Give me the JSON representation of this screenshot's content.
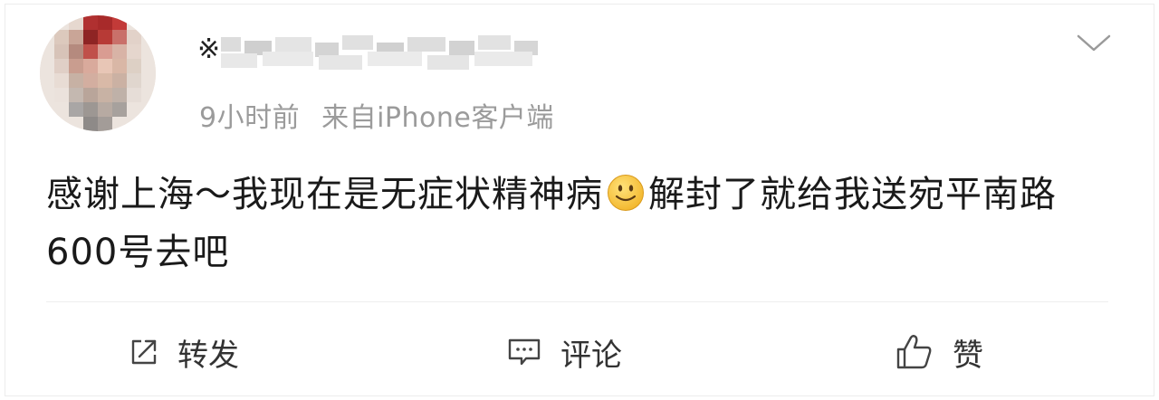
{
  "post": {
    "author_name_visible": "※",
    "meta": {
      "time": "9小时前",
      "source": "来自iPhone客户端"
    },
    "content_part1": "感谢上海～我现在是无症状精神病",
    "emoji": "smile-emoji",
    "content_part2": "解封了就给我送宛平南路600号去吧"
  },
  "actions": {
    "repost_label": "转发",
    "comment_label": "评论",
    "like_label": "赞"
  },
  "colors": {
    "meta_text": "#9b9b9b",
    "content_text": "#1a1a1a",
    "action_text": "#333333",
    "emoji_face": "#f6c53a"
  }
}
